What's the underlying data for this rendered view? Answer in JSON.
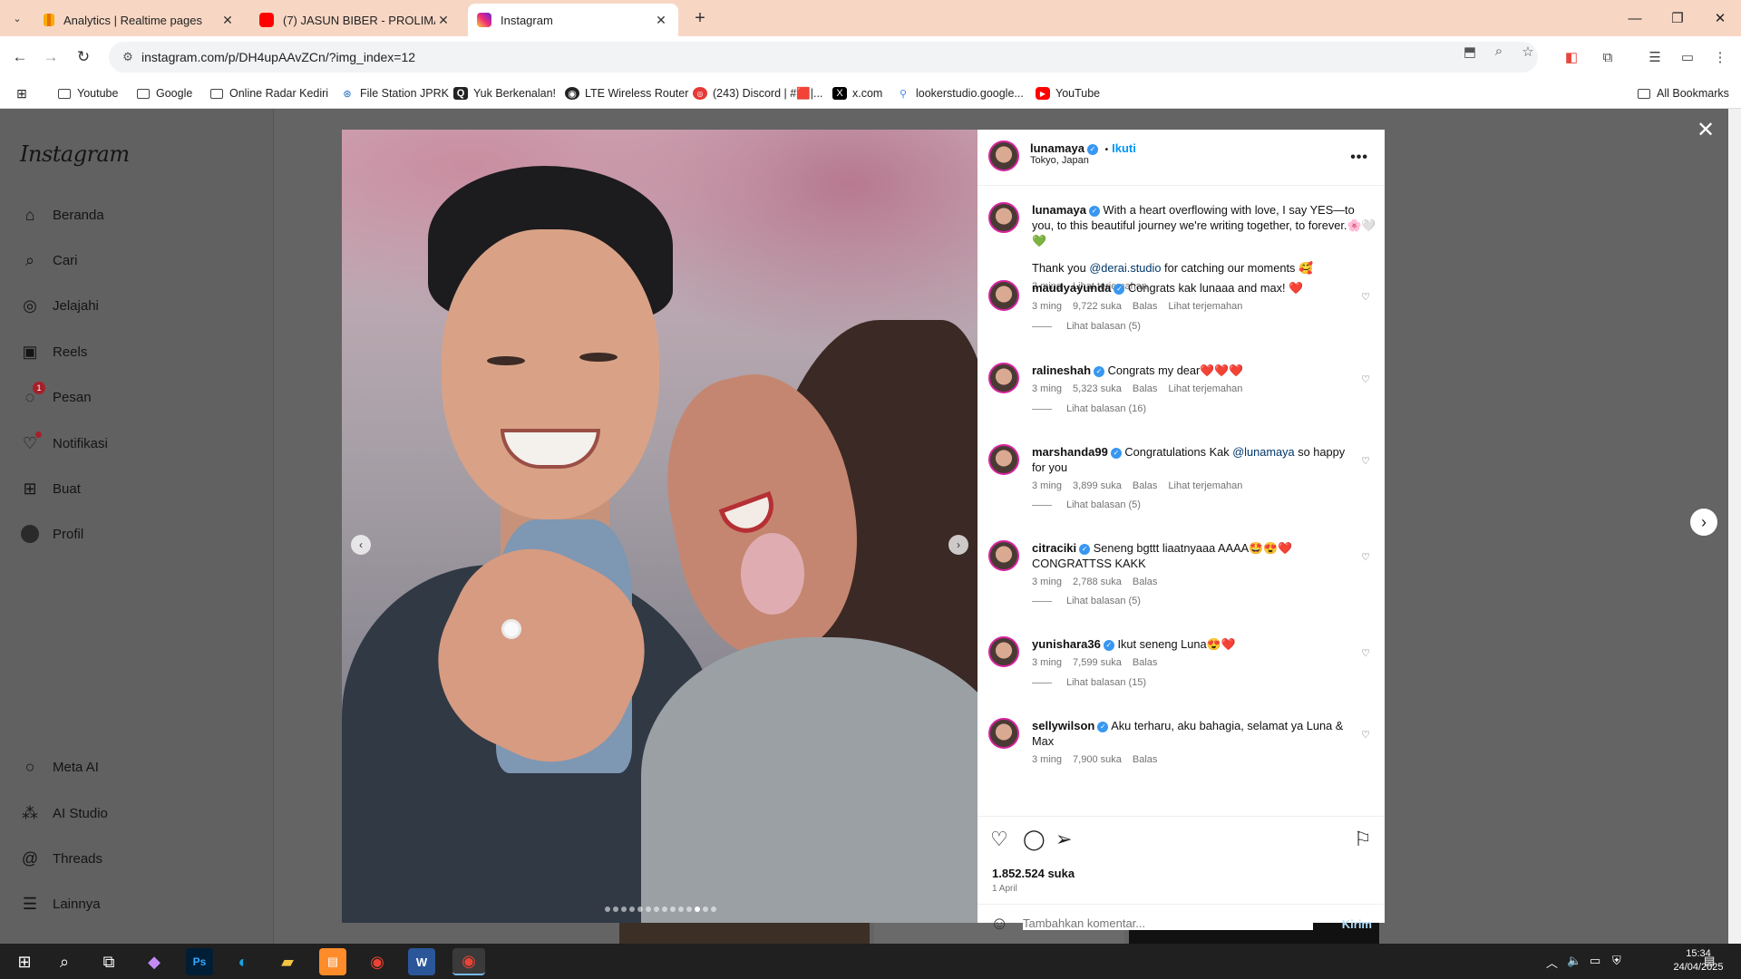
{
  "browser": {
    "tabs": [
      {
        "title": "Analytics | Realtime pages",
        "icon": "analytics-icon",
        "color": "#f9ab00"
      },
      {
        "title": "(7) JASUN BIBER - PROLIMAN JAYA",
        "icon": "youtube-icon",
        "color": "#ff0000"
      },
      {
        "title": "Instagram",
        "icon": "instagram-icon",
        "color": "#e1306c",
        "active": true
      }
    ],
    "url": "instagram.com/p/DH4upAAvZCn/?img_index=12",
    "bookmarks": [
      {
        "label": "Youtube",
        "icon": "folder-icon"
      },
      {
        "label": "Google",
        "icon": "folder-icon"
      },
      {
        "label": "Online Radar Kediri",
        "icon": "folder-icon"
      },
      {
        "label": "File Station JPRK",
        "icon": "filestation-icon"
      },
      {
        "label": "Yuk Berkenalan!",
        "icon": "quora-icon"
      },
      {
        "label": "LTE Wireless Router",
        "icon": "router-icon"
      },
      {
        "label": "(243) Discord | #🟥|...",
        "icon": "discord-icon"
      },
      {
        "label": "x.com",
        "icon": "x-icon"
      },
      {
        "label": "lookerstudio.google...",
        "icon": "lookerstudio-icon"
      },
      {
        "label": "YouTube",
        "icon": "youtube-icon"
      }
    ],
    "all_bookmarks": "All Bookmarks"
  },
  "sidebar": {
    "logo": "Instagram",
    "items": [
      {
        "label": "Beranda",
        "icon": "home-icon"
      },
      {
        "label": "Cari",
        "icon": "search-icon"
      },
      {
        "label": "Jelajahi",
        "icon": "explore-icon"
      },
      {
        "label": "Reels",
        "icon": "reels-icon"
      },
      {
        "label": "Pesan",
        "icon": "messenger-icon",
        "badge": "1"
      },
      {
        "label": "Notifikasi",
        "icon": "heart-icon"
      },
      {
        "label": "Buat",
        "icon": "create-icon"
      },
      {
        "label": "Profil",
        "icon": "profile-icon"
      }
    ],
    "bottom_items": [
      {
        "label": "Meta AI",
        "icon": "meta-ai-icon"
      },
      {
        "label": "AI Studio",
        "icon": "ai-studio-icon"
      },
      {
        "label": "Threads",
        "icon": "threads-icon"
      },
      {
        "label": "Lainnya",
        "icon": "menu-icon"
      }
    ]
  },
  "post": {
    "author": "lunamaya",
    "follow": "Ikuti",
    "location": "Tokyo, Japan",
    "caption_line1": "With a heart overflowing with love, I say YES—to you, to this beautiful journey we're writing together, to forever.🌸🤍💚",
    "caption_line2_pre": "Thank you ",
    "caption_mention": "@derai.studio",
    "caption_line2_post": " for catching our moments 🥰",
    "caption_time": "3 ming",
    "caption_translate": "Lihat terjemahan",
    "likes": "1.852.524 suka",
    "date": "1 April",
    "comment_placeholder": "Tambahkan komentar...",
    "send": "Kirim",
    "slide_count": 14,
    "slide_active": 12
  },
  "comments": [
    {
      "user": "maudyayunda",
      "text": "Congrats kak lunaaa and max! ❤️",
      "time": "3 ming",
      "likes": "9,722 suka",
      "reply": "Balas",
      "translate": "Lihat terjemahan",
      "replies": "Lihat balasan (5)"
    },
    {
      "user": "ralineshah",
      "text": "Congrats my dear❤️❤️❤️",
      "time": "3 ming",
      "likes": "5,323 suka",
      "reply": "Balas",
      "translate": "Lihat terjemahan",
      "replies": "Lihat balasan (16)"
    },
    {
      "user": "marshanda99",
      "text_pre": "Congratulations Kak ",
      "mention": "@lunamaya",
      "text_post": " so happy for you",
      "time": "3 ming",
      "likes": "3,899 suka",
      "reply": "Balas",
      "translate": "Lihat terjemahan",
      "replies": "Lihat balasan (5)"
    },
    {
      "user": "citraciki",
      "text": "Seneng bgttt liaatnyaaa AAAA🤩😍❤️ CONGRATTSS KAKK",
      "time": "3 ming",
      "likes": "2,788 suka",
      "reply": "Balas",
      "replies": "Lihat balasan (5)"
    },
    {
      "user": "yunishara36",
      "text": "Ikut seneng Luna😍❤️",
      "time": "3 ming",
      "likes": "7,599 suka",
      "reply": "Balas",
      "replies": "Lihat balasan (15)"
    },
    {
      "user": "sellywilson",
      "text": "Aku terharu, aku bahagia, selamat ya Luna & Max",
      "time": "3 ming",
      "likes": "7,900 suka",
      "reply": "Balas"
    }
  ],
  "taskbar": {
    "time": "15:34",
    "date": "24/04/2025"
  },
  "colors": {
    "link": "#0095f6",
    "overlay": "#646464",
    "tabbar": "#f7d7c4"
  }
}
